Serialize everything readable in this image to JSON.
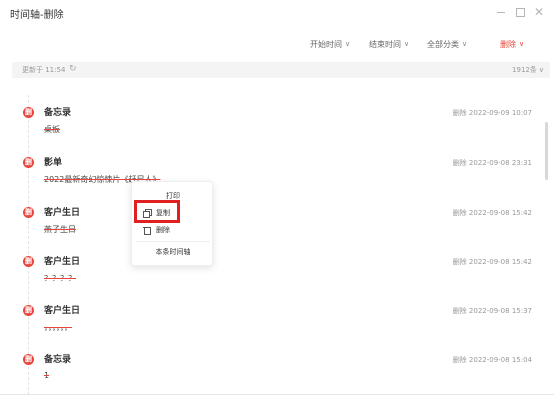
{
  "window": {
    "title": "时间轴-删除"
  },
  "filters": {
    "start_time": "开始时间",
    "end_time": "结束时间",
    "category": "全部分类",
    "deleted": "删除"
  },
  "status": {
    "updated": "更新于 11:54",
    "count": "1912条"
  },
  "entries": [
    {
      "title": "备忘录",
      "time": "删除 2022-09-09 10:07",
      "content": "桌板"
    },
    {
      "title": "影单",
      "time": "删除 2022-09-08 23:31",
      "content": "2022最新奇幻惊悚片《赶尸人》"
    },
    {
      "title": "客户生日",
      "time": "删除 2022-09-08 15:42",
      "content": "燕子生日"
    },
    {
      "title": "客户生日",
      "time": "删除 2022-09-08 15:42",
      "content": "？？？？"
    },
    {
      "title": "客户生日",
      "time": "删除 2022-09-08 15:37",
      "content": "，，，，，，"
    },
    {
      "title": "备忘录",
      "time": "删除 2022-09-08 15:04",
      "content": "1"
    }
  ],
  "context_menu": {
    "print": "打印",
    "copy": "复制",
    "delete": "删除",
    "view_timeline": "本条时间轴"
  },
  "icons": {
    "entry_badge": "删",
    "refresh": "refresh-icon",
    "chevron": "chevron-down-icon"
  },
  "colors": {
    "accent": "#e8453c",
    "highlight": "#e02020"
  }
}
